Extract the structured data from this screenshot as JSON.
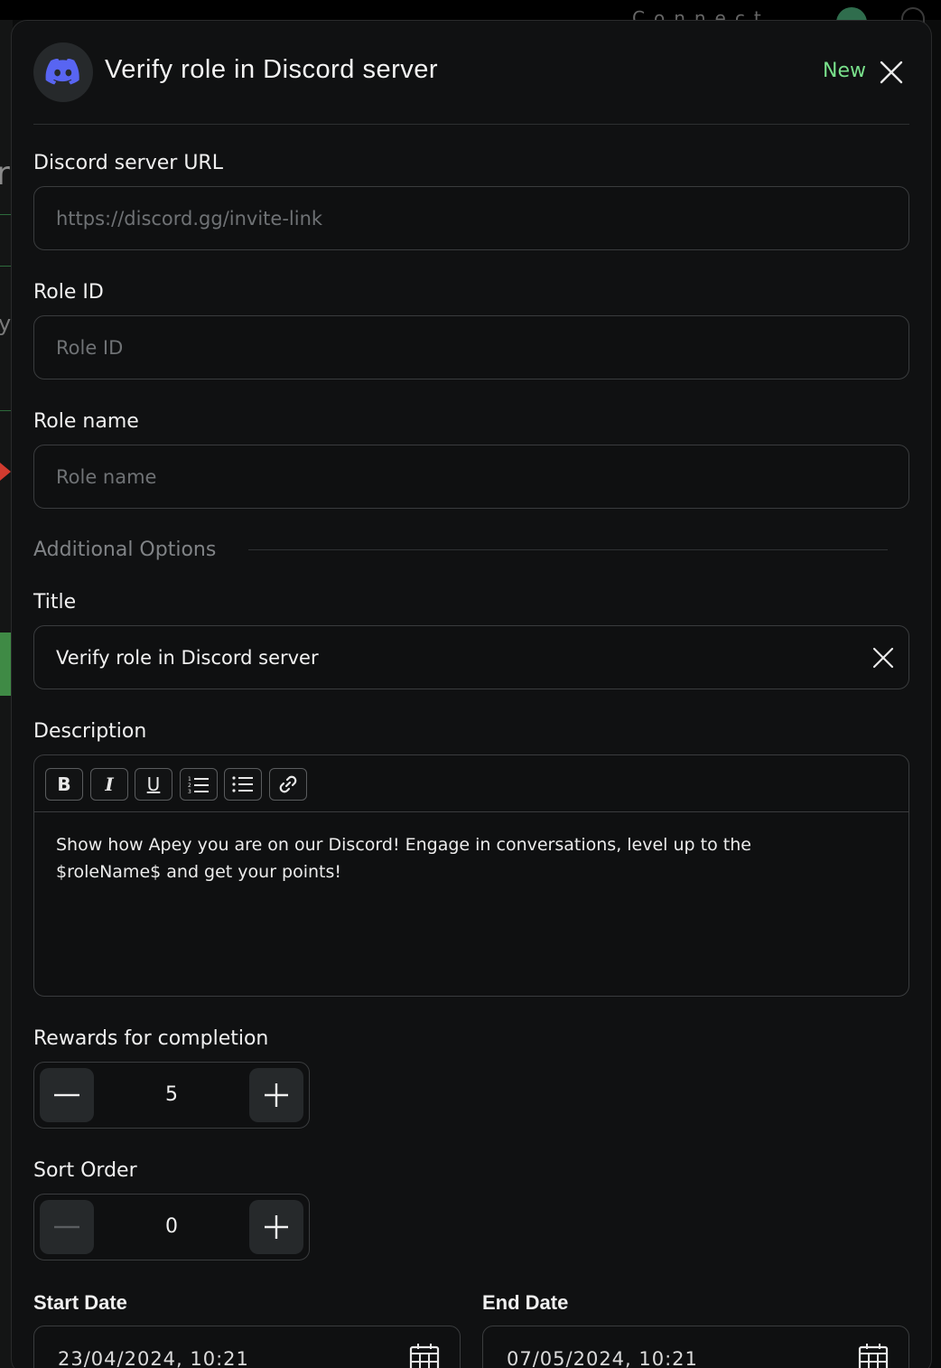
{
  "background": {
    "top_text": "Connect wallet"
  },
  "modal": {
    "title": "Verify role in Discord server",
    "badge": "New",
    "icon": "discord-icon",
    "close_icon": "close-icon",
    "colors": {
      "accent": "#79e08b",
      "discord": "#5865f2",
      "background": "#101112"
    }
  },
  "fields": {
    "server_url": {
      "label": "Discord server URL",
      "placeholder": "https://discord.gg/invite-link",
      "value": ""
    },
    "role_id": {
      "label": "Role ID",
      "placeholder": "Role ID",
      "value": ""
    },
    "role_name": {
      "label": "Role name",
      "placeholder": "Role name",
      "value": ""
    }
  },
  "additional": {
    "section_title": "Additional Options",
    "title": {
      "label": "Title",
      "value": "Verify role in Discord server"
    },
    "description": {
      "label": "Description",
      "toolbar": [
        {
          "name": "bold-button",
          "glyph": "B"
        },
        {
          "name": "italic-button",
          "glyph": "I"
        },
        {
          "name": "underline-button",
          "glyph": "U"
        },
        {
          "name": "ordered-list-button",
          "glyph": "ordered-list-icon"
        },
        {
          "name": "bullet-list-button",
          "glyph": "bullet-list-icon"
        },
        {
          "name": "link-button",
          "glyph": "link-icon"
        }
      ],
      "text_line1": "Show how Apey you are on our Discord! Engage in conversations, level up to the",
      "text_line2": "$roleName$ and get your points!"
    },
    "rewards": {
      "label": "Rewards for completion",
      "value": "5"
    },
    "sort_order": {
      "label": "Sort Order",
      "value": "0"
    },
    "start_date": {
      "label": "Start Date",
      "value": "23/04/2024, 10:21"
    },
    "end_date": {
      "label": "End Date",
      "value": "07/05/2024, 10:21"
    }
  }
}
